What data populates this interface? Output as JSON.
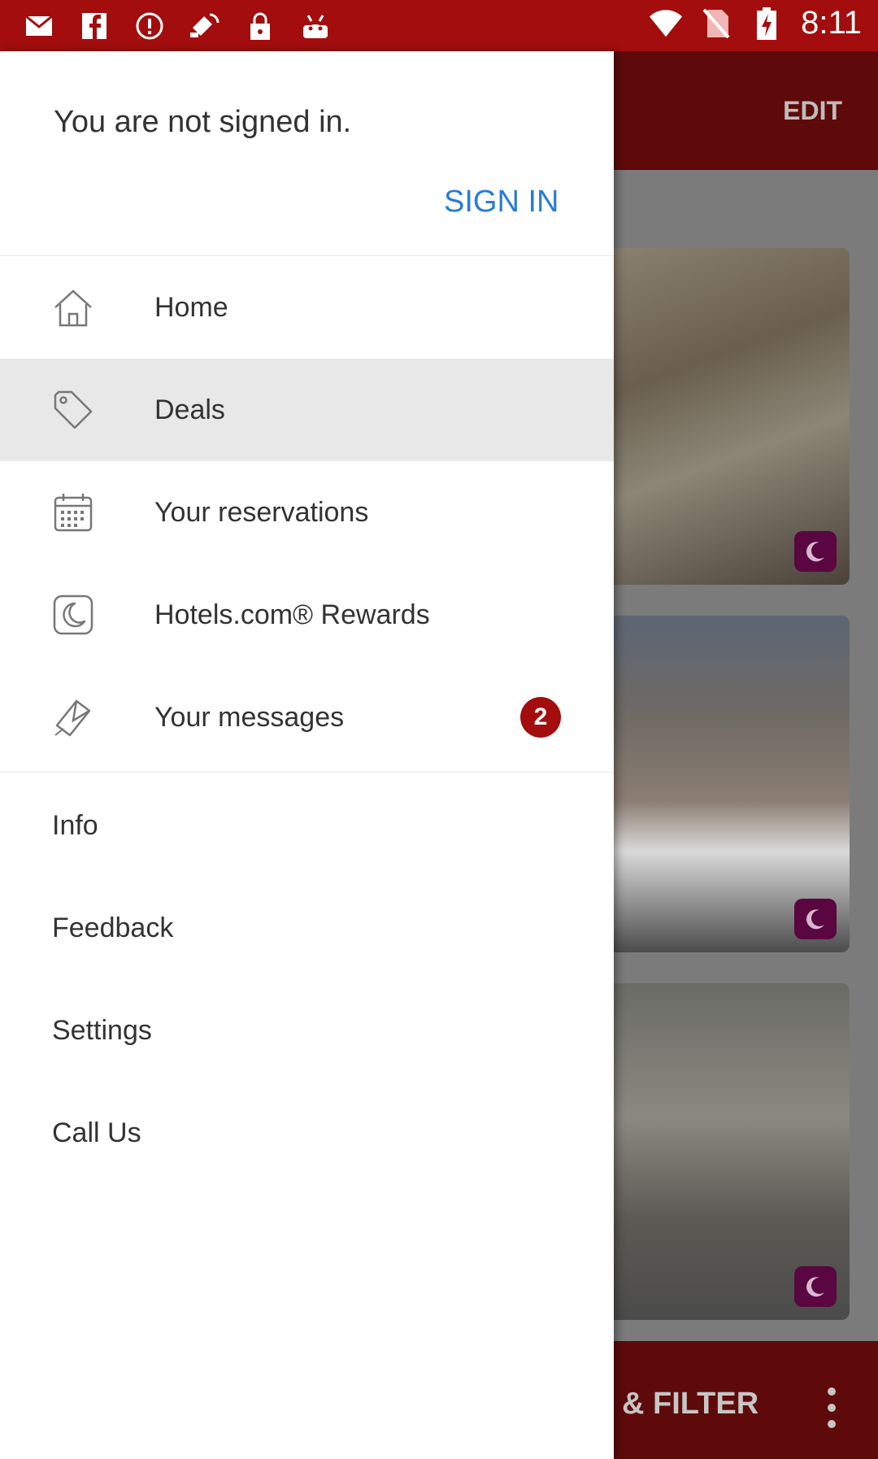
{
  "status_bar": {
    "time": "8:11",
    "left_icons": [
      "mail-icon",
      "facebook-icon",
      "info-icon",
      "satellite-icon",
      "lock-icon",
      "android-icon"
    ],
    "right_icons": [
      "wifi-icon",
      "no-sim-icon",
      "battery-charging-icon"
    ]
  },
  "background_app": {
    "header_action": "EDIT",
    "bottom_action": "& FILTER",
    "more_icon": "more-vert-icon",
    "card_icon": "moon-icon"
  },
  "drawer": {
    "signed_status": "You are not signed in.",
    "sign_in": "SIGN IN",
    "items": [
      {
        "label": "Home",
        "icon": "home-icon"
      },
      {
        "label": "Deals",
        "icon": "tag-icon"
      },
      {
        "label": "Your reservations",
        "icon": "calendar-icon"
      },
      {
        "label": "Hotels.com® Rewards",
        "icon": "rewards-moon-icon"
      },
      {
        "label": "Your messages",
        "icon": "envelope-icon",
        "badge": "2"
      }
    ],
    "secondary": [
      "Info",
      "Feedback",
      "Settings",
      "Call Us"
    ]
  },
  "colors": {
    "status_bar": "#a30d0d",
    "accent_link": "#2a7bd4",
    "badge": "#a30d0d",
    "active_item_bg": "#e8e8e8"
  }
}
